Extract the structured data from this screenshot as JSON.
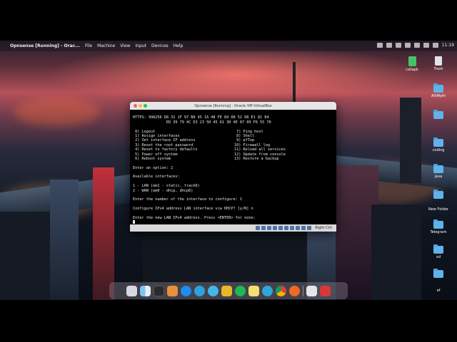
{
  "menubar": {
    "app_name": "Opnsense [Running] - Orac...",
    "items": [
      "File",
      "Machine",
      "View",
      "Input",
      "Devices",
      "Help"
    ],
    "clock": "11:19"
  },
  "desktop_icons": [
    {
      "label": "callapk",
      "type": "apk"
    },
    {
      "label": "Trash",
      "type": "trash"
    },
    {
      "label": "AlliMyth",
      "type": "folder"
    },
    {
      "label": "",
      "type": "folder"
    },
    {
      "label": "coding",
      "type": "folder"
    },
    {
      "label": "java",
      "type": "folder"
    },
    {
      "label": "",
      "type": "folder"
    },
    {
      "label": "New Folder",
      "type": "folder"
    },
    {
      "label": "Telegram",
      "type": "folder"
    },
    {
      "label": "xd",
      "type": "folder"
    },
    {
      "label": "",
      "type": "folder"
    },
    {
      "label": "ef",
      "type": "folder"
    }
  ],
  "vbox": {
    "title": "Opnsense [Running] - Oracle VM VirtualBox",
    "host_key": "Right Ctrl",
    "console": {
      "https_line1": "HTTPS: SHA256 D8 31 1F 97 B8 45 16 48 FE 84 08 52 08 E1 81 84",
      "https_line2": "               ED 39 79 4C E3 23 50 45 61 30 4E 07 09 F6 55 70",
      "menu_left": [
        " 0) Logout",
        " 1) Assign interfaces",
        " 2) Set interface IP address",
        " 3) Reset the root password",
        " 4) Reset to factory defaults",
        " 5) Power off system",
        " 6) Reboot system"
      ],
      "menu_right": [
        " 7) Ping host",
        " 8) Shell",
        " 9) pfTop",
        "10) Firewall log",
        "11) Reload all services",
        "12) Update from console",
        "13) Restore a backup"
      ],
      "prompt_option": "Enter an option: 2",
      "available_header": "Available interfaces:",
      "iface1": "1 - LAN (em1 - static, track6)",
      "iface2": "2 - WAN (em0 - dhcp, dhcp6)",
      "prompt_iface": "Enter the number of the interface to configure: 1",
      "prompt_dhcp": "Configure IPv4 address LAN interface via DHCP? [y/N] n",
      "prompt_ipv4": "Enter the new LAN IPv4 address. Press <ENTER> for none:"
    }
  },
  "dock_apps": [
    "launchpad",
    "finder",
    "terminal",
    "instruments",
    "app-store",
    "telegram",
    "vpn",
    "vscode",
    "spotify",
    "notes",
    "edge",
    "chrome",
    "firefox",
    "trash-dock",
    "virtualbox"
  ]
}
